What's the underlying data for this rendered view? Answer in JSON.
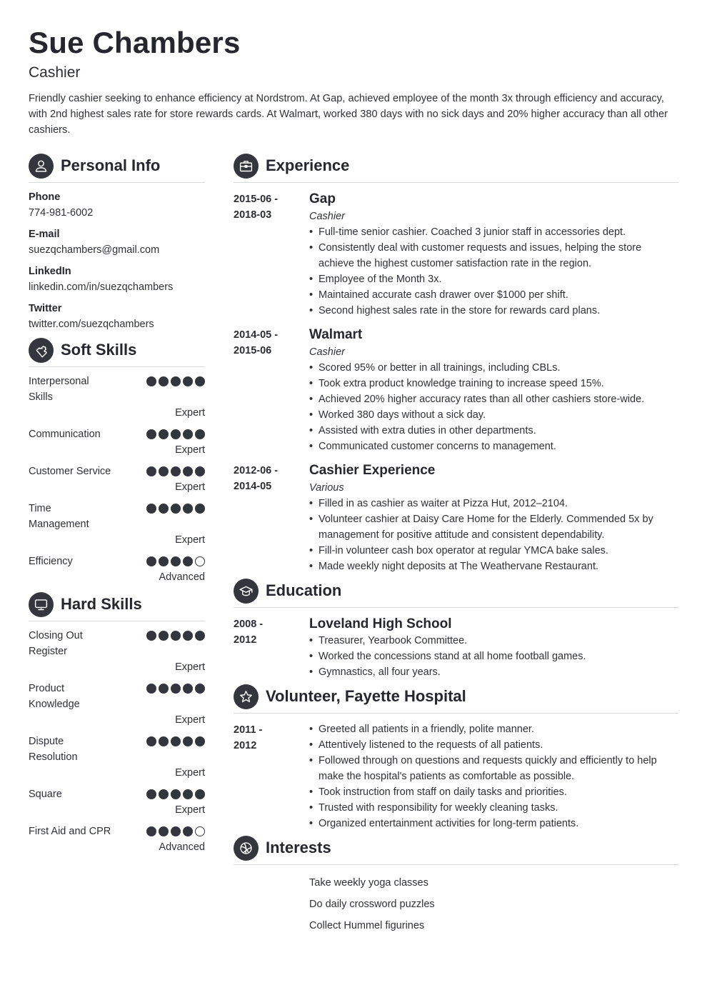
{
  "header": {
    "name": "Sue Chambers",
    "title": "Cashier",
    "summary": "Friendly cashier seeking to enhance efficiency at Nordstrom. At Gap, achieved employee of the month 3x through efficiency and accuracy, with 2nd highest sales rate for store rewards cards. At Walmart, worked 380 days with no sick days and 20% higher accuracy than all other cashiers."
  },
  "personal_info": {
    "heading": "Personal Info",
    "icon": "user-icon",
    "items": [
      {
        "label": "Phone",
        "value": "774-981-6002"
      },
      {
        "label": "E-mail",
        "value": "suezqchambers@gmail.com"
      },
      {
        "label": "LinkedIn",
        "value": "linkedin.com/in/suezqchambers"
      },
      {
        "label": "Twitter",
        "value": "twitter.com/suezqchambers"
      }
    ]
  },
  "soft_skills": {
    "heading": "Soft Skills",
    "icon": "puzzle-icon",
    "items": [
      {
        "name": "Interpersonal Skills",
        "rating": 5,
        "max": 5,
        "level": "Expert"
      },
      {
        "name": "Communication",
        "rating": 5,
        "max": 5,
        "level": "Expert"
      },
      {
        "name": "Customer Service",
        "rating": 5,
        "max": 5,
        "level": "Expert"
      },
      {
        "name": "Time Management",
        "rating": 5,
        "max": 5,
        "level": "Expert"
      },
      {
        "name": "Efficiency",
        "rating": 4,
        "max": 5,
        "level": "Advanced"
      }
    ]
  },
  "hard_skills": {
    "heading": "Hard Skills",
    "icon": "monitor-icon",
    "items": [
      {
        "name": "Closing Out Register",
        "rating": 5,
        "max": 5,
        "level": "Expert"
      },
      {
        "name": "Product Knowledge",
        "rating": 5,
        "max": 5,
        "level": "Expert"
      },
      {
        "name": "Dispute Resolution",
        "rating": 5,
        "max": 5,
        "level": "Expert"
      },
      {
        "name": "Square",
        "rating": 5,
        "max": 5,
        "level": "Expert"
      },
      {
        "name": "First Aid and CPR",
        "rating": 4,
        "max": 5,
        "level": "Advanced"
      }
    ]
  },
  "experience": {
    "heading": "Experience",
    "icon": "briefcase-icon",
    "entries": [
      {
        "date_start": "2015-06 -",
        "date_end": "2018-03",
        "title": "Gap",
        "subtitle": "Cashier",
        "bullets": [
          "Full-time senior cashier. Coached 3 junior staff in accessories dept.",
          "Consistently deal with customer requests and issues, helping the store achieve the highest customer satisfaction rate in the region.",
          "Employee of the Month 3x.",
          "Maintained accurate cash drawer over $1000 per shift.",
          "Second highest sales rate in the store for rewards card plans."
        ]
      },
      {
        "date_start": "2014-05 -",
        "date_end": "2015-06",
        "title": "Walmart",
        "subtitle": "Cashier",
        "bullets": [
          "Scored 95% or better in all trainings, including CBLs.",
          "Took extra product knowledge training to increase speed 15%.",
          "Achieved 20% higher accuracy rates than all other cashiers store-wide.",
          "Worked 380 days without a sick day.",
          "Assisted with extra duties in other departments.",
          "Communicated customer concerns to management."
        ]
      },
      {
        "date_start": "2012-06 -",
        "date_end": "2014-05",
        "title": "Cashier Experience",
        "subtitle": "Various",
        "bullets": [
          "Filled in as cashier as waiter at Pizza Hut, 2012–2104.",
          "Volunteer cashier at Daisy Care Home for the Elderly. Commended 5x by management for positive attitude and consistent dependability.",
          "Fill-in volunteer cash box operator at regular YMCA bake sales.",
          "Made weekly night deposits at The Weathervane Restaurant."
        ]
      }
    ]
  },
  "education": {
    "heading": "Education",
    "icon": "graduation-cap-icon",
    "entries": [
      {
        "date_start": "2008 -",
        "date_end": "2012",
        "title": "Loveland High School",
        "bullets": [
          "Treasurer, Yearbook Committee.",
          "Worked the concessions stand at all home football games.",
          "Gymnastics, all four years."
        ]
      }
    ]
  },
  "volunteer": {
    "heading": "Volunteer, Fayette Hospital",
    "icon": "star-icon",
    "entries": [
      {
        "date_start": "2011 -",
        "date_end": "2012",
        "bullets": [
          "Greeted all patients in a friendly, polite manner.",
          "Attentively listened to the requests of all patients.",
          "Followed through on questions and requests quickly and efficiently to help make the hospital's patients as comfortable as possible.",
          "Took instruction from staff on daily tasks and priorities.",
          "Trusted with responsibility for weekly cleaning tasks.",
          "Organized entertainment activities for long-term patients."
        ]
      }
    ]
  },
  "interests": {
    "heading": "Interests",
    "icon": "basketball-icon",
    "items": [
      "Take weekly yoga classes",
      "Do daily crossword puzzles",
      "Collect Hummel figurines"
    ]
  },
  "colors": {
    "icon_bg": "#33363d",
    "text": "#2b2d33",
    "divider": "#d8d9db"
  }
}
